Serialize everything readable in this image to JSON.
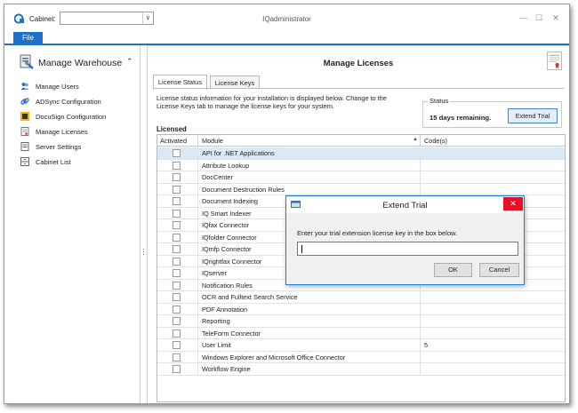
{
  "app": {
    "title": "IQadministrator",
    "cabinet_label": "Cabinet:",
    "cabinet_value": "",
    "menu_file": "File",
    "window_buttons": {
      "minimize": "—",
      "maximize": "☐",
      "close": "✕"
    }
  },
  "nav": {
    "header": "Manage Warehouse",
    "collapse_glyph": "⌃",
    "items": [
      {
        "label": "Manage Users",
        "icon": "users-icon"
      },
      {
        "label": "ADSync Configuration",
        "icon": "link-icon"
      },
      {
        "label": "DocuSign Configuration",
        "icon": "docusign-icon"
      },
      {
        "label": "Manage Licenses",
        "icon": "license-icon"
      },
      {
        "label": "Server Settings",
        "icon": "server-icon"
      },
      {
        "label": "Cabinet List",
        "icon": "cabinet-icon"
      }
    ]
  },
  "main": {
    "title": "Manage Licenses",
    "tabs": [
      "License Status",
      "License Keys"
    ],
    "description": "License status information for your installation is displayed below.  Change to the License Keys tab to manage the license keys for your system.",
    "status_legend": "Status",
    "status_text": "15 days remaining.",
    "extend_trial_label": "Extend Trial",
    "licensed_label": "Licensed",
    "columns": [
      "Activated",
      "Module",
      "Code(s)"
    ],
    "sort_glyph": "▲",
    "rows": [
      {
        "module": "API for .NET Applications",
        "code": ""
      },
      {
        "module": "Attribute Lookup",
        "code": ""
      },
      {
        "module": "DocCenter",
        "code": ""
      },
      {
        "module": "Document Destruction Rules",
        "code": ""
      },
      {
        "module": "Document Indexing",
        "code": ""
      },
      {
        "module": "IQ Smart Indexer",
        "code": ""
      },
      {
        "module": "IQfax Connector",
        "code": ""
      },
      {
        "module": "IQfolder Connector",
        "code": ""
      },
      {
        "module": "IQmfp Connector",
        "code": ""
      },
      {
        "module": "IQrightfax Connector",
        "code": ""
      },
      {
        "module": "IQserver",
        "code": ""
      },
      {
        "module": "Notification Rules",
        "code": ""
      },
      {
        "module": "OCR and Fulltext Search Service",
        "code": ""
      },
      {
        "module": "PDF Annotation",
        "code": ""
      },
      {
        "module": "Reporting",
        "code": ""
      },
      {
        "module": "TeleForm Connector",
        "code": ""
      },
      {
        "module": "User Limit",
        "code": "5"
      },
      {
        "module": "Windows Explorer and Microsoft Office Connector",
        "code": ""
      },
      {
        "module": "Workflow Engine",
        "code": ""
      }
    ]
  },
  "dialog": {
    "title": "Extend Trial",
    "message": "Enter your trial extension license key in the box below.",
    "input_value": "",
    "ok_label": "OK",
    "cancel_label": "Cancel",
    "close_glyph": "✕"
  },
  "colors": {
    "accent": "#1e70c8",
    "close_red": "#e81123",
    "selected_row": "#dbe8f6"
  }
}
